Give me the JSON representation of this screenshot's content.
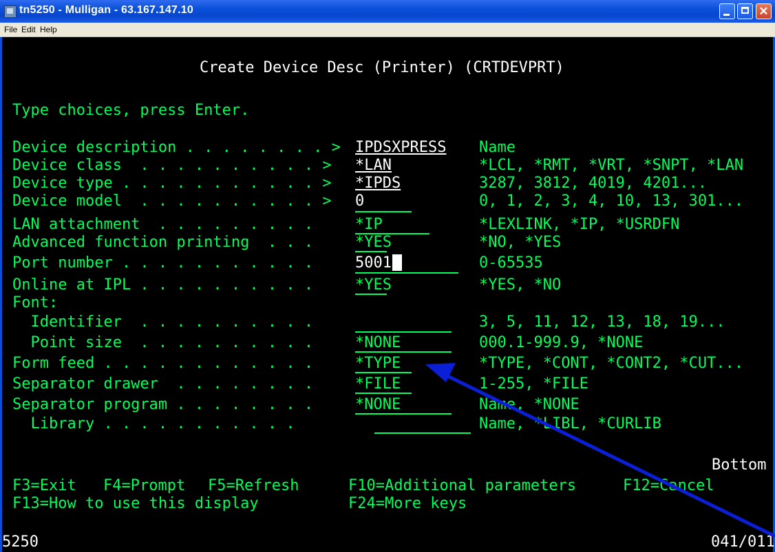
{
  "window": {
    "title": "tn5250 - Mulligan - 63.167.147.10",
    "menu": [
      "File",
      "Edit",
      "Help"
    ]
  },
  "screen": {
    "heading": "Create Device Desc (Printer) (CRTDEVPRT)",
    "instruction": "Type choices, press Enter.",
    "rows": [
      {
        "label": "Device description . . . . . . . . >",
        "value": "IPDSXPRESS",
        "hint": "Name"
      },
      {
        "label": "Device class  . . . . . . . . . . >",
        "value": "*LAN",
        "hint": "*LCL, *RMT, *VRT, *SNPT, *LAN"
      },
      {
        "label": "Device type . . . . . . . . . . . >",
        "value": "*IPDS",
        "hint": "3287, 3812, 4019, 4201..."
      },
      {
        "label": "Device model  . . . . . . . . . . >",
        "value": "0",
        "hint": "0, 1, 2, 3, 4, 10, 13, 301..."
      },
      {
        "label": "LAN attachment  . . . . . . . . .",
        "value": "*IP",
        "hint": "*LEXLINK, *IP, *USRDFN"
      },
      {
        "label": "Advanced function printing  . . .",
        "value": "*YES",
        "hint": "*NO, *YES"
      },
      {
        "label": "Port number . . . . . . . . . . .",
        "value": "5001",
        "hint": "0-65535"
      },
      {
        "label": "Online at IPL . . . . . . . . . .",
        "value": "*YES",
        "hint": "*YES, *NO"
      },
      {
        "label": "Font:",
        "value": "",
        "hint": ""
      },
      {
        "label": "  Identifier  . . . . . . . . . .",
        "value": "",
        "hint": "3, 5, 11, 12, 13, 18, 19..."
      },
      {
        "label": "  Point size  . . . . . . . . . .",
        "value": "*NONE",
        "hint": "000.1-999.9, *NONE"
      },
      {
        "label": "Form feed . . . . . . . . . . . .",
        "value": "*TYPE",
        "hint": "*TYPE, *CONT, *CONT2, *CUT..."
      },
      {
        "label": "Separator drawer  . . . . . . . .",
        "value": "*FILE",
        "hint": "1-255, *FILE"
      },
      {
        "label": "Separator program . . . . . . . .",
        "value": "*NONE",
        "hint": "Name, *NONE"
      },
      {
        "label": "  Library . . . . . . . . . . .",
        "value": "",
        "hint": "Name, *LIBL, *CURLIB"
      }
    ],
    "more": "Bottom",
    "fkeys_line1": [
      "F3=Exit",
      "F4=Prompt",
      "F5=Refresh",
      "F10=Additional parameters",
      "F12=Cancel"
    ],
    "fkeys_line2": [
      "F13=How to use this display",
      "F24=More keys"
    ]
  },
  "status": {
    "left": "5250",
    "right": "041/011"
  },
  "colors": {
    "terminal_bg": "#000000",
    "terminal_text": "#00ff5a",
    "heading_text": "#ffffff",
    "annotation_arrow": "#0a1fd6"
  }
}
